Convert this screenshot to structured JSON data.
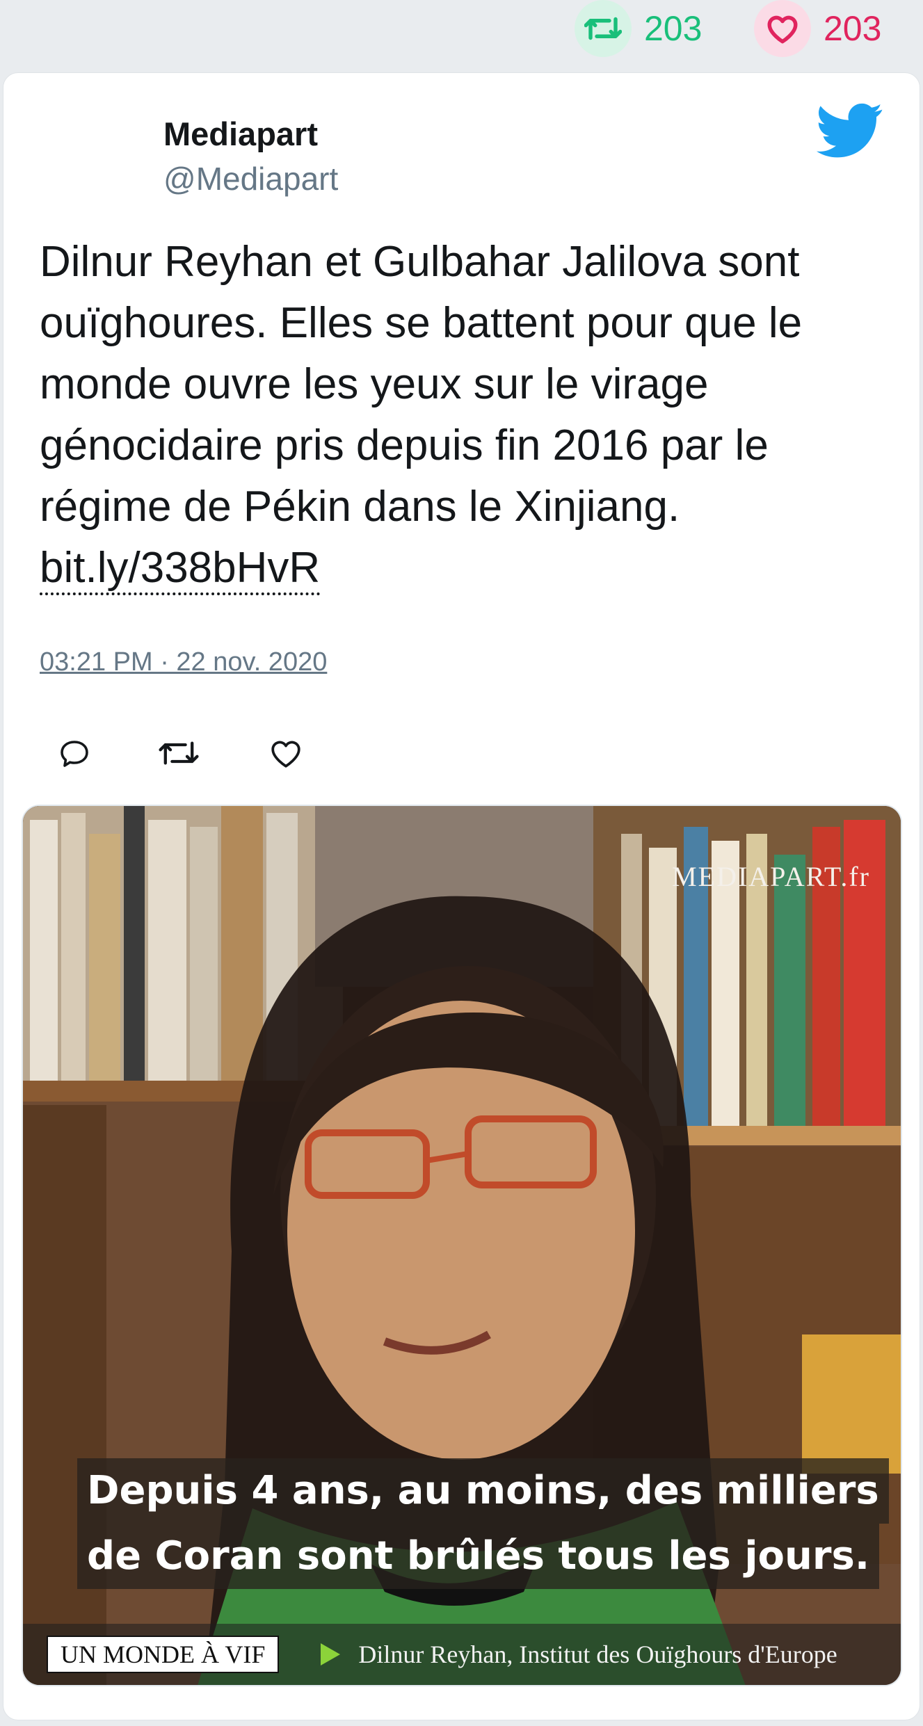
{
  "stats": {
    "retweets": "203",
    "likes": "203",
    "retweet_icon": "retweet-icon",
    "like_icon": "heart-icon"
  },
  "tweet": {
    "author_name": "Mediapart",
    "author_handle": "@Mediapart",
    "text": "Dilnur Reyhan et Gulbahar Jalilova sont ouïghoures. Elles se battent pour que le monde ouvre les yeux sur le virage génocidaire pris depuis fin 2016 par le régime de Pékin dans le Xinjiang.",
    "link": "bit.ly/338bHvR",
    "timestamp": "03:21 PM · 22 nov. 2020",
    "actions": [
      "reply-icon",
      "retweet-icon",
      "heart-icon"
    ]
  },
  "media": {
    "watermark": "MEDIAPART.fr",
    "subtitle_line1": "Depuis 4 ans, au moins, des milliers",
    "subtitle_line2": "de Coran sont brûlés tous les jours.",
    "program_badge": "UN MONDE À VIF",
    "credit": "Dilnur Reyhan, Institut des Ouïghours d'Europe"
  },
  "colors": {
    "retweet_green": "#19bf7a",
    "like_pink": "#e0245e",
    "twitter_blue": "#1da1f2",
    "muted_text": "#657786"
  }
}
